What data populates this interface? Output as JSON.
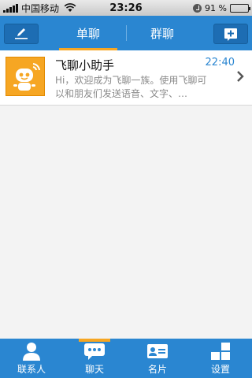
{
  "status_bar": {
    "carrier": "中国移动",
    "time": "23:26",
    "battery": "91 %",
    "battery_level": 0.91
  },
  "header": {
    "left_icon": "compose-icon",
    "right_icon": "add-icon",
    "tabs": [
      {
        "label": "单聊",
        "active": true
      },
      {
        "label": "群聊",
        "active": false
      }
    ]
  },
  "chats": [
    {
      "name": "飞聊小助手",
      "time": "22:40",
      "preview": "Hi，欢迎成为飞聊一族。使用飞聊可以和朋友们发送语音、文字、…"
    }
  ],
  "tabbar": {
    "items": [
      {
        "label": "联系人",
        "icon": "contacts-icon",
        "active": false
      },
      {
        "label": "聊天",
        "icon": "chat-icon",
        "active": true
      },
      {
        "label": "名片",
        "icon": "card-icon",
        "active": false
      },
      {
        "label": "设置",
        "icon": "settings-icon",
        "active": false
      }
    ]
  },
  "colors": {
    "header": "#2a86d1",
    "accent": "#f6a623",
    "time_text": "#2a86d1"
  }
}
